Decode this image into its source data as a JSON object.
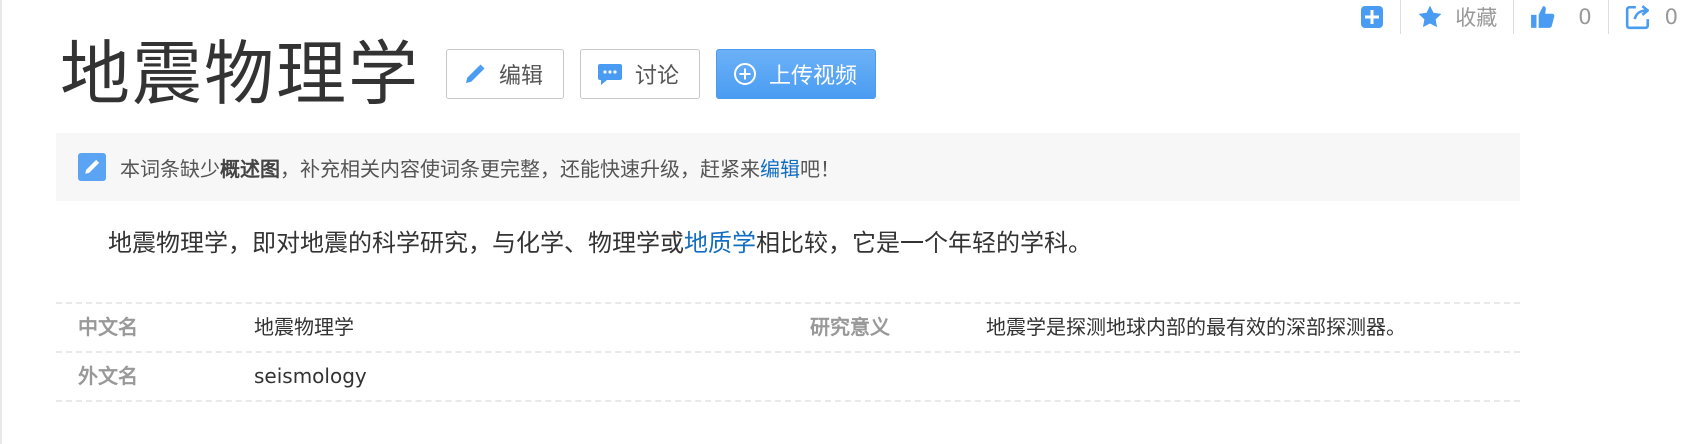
{
  "toolbar": {
    "favorite_label": "收藏",
    "like_count": "0",
    "share_count": "0"
  },
  "title": "地震物理学",
  "buttons": {
    "edit": "编辑",
    "discuss": "讨论",
    "upload_video": "上传视频"
  },
  "notice": {
    "prefix": "本词条缺少",
    "bold": "概述图",
    "middle": "，补充相关内容使词条更完整，还能快速升级，赶紧来",
    "link": "编辑",
    "suffix": "吧！"
  },
  "summary": {
    "before": "地震物理学，即对地震的科学研究，与化学、物理学或",
    "link": "地质学",
    "after": "相比较，它是一个年轻的学科。"
  },
  "basic_info": {
    "rows": [
      {
        "k1": "中文名",
        "v1": "地震物理学",
        "k2": "研究意义",
        "v2": "地震学是探测地球内部的最有效的深部探测器。"
      },
      {
        "k1": "外文名",
        "v1": "seismology",
        "k2": "",
        "v2": ""
      }
    ]
  },
  "colors": {
    "accent": "#4a9cf2",
    "link": "#136ec2",
    "notice_bg": "#f7f7f7"
  }
}
